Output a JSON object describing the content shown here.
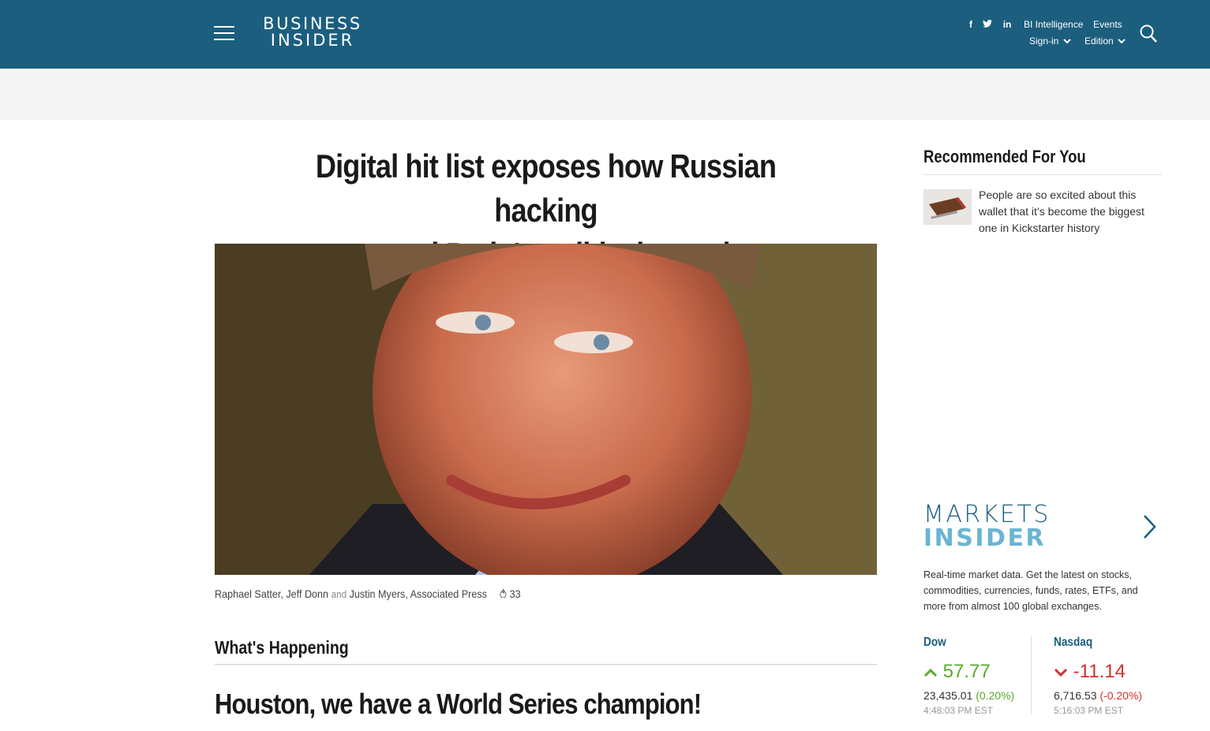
{
  "header": {
    "brand_line1": "BUSINESS",
    "brand_line2": "INSIDER",
    "social": [
      "f",
      "t",
      "in"
    ],
    "links": {
      "bi_intelligence": "BI Intelligence",
      "events": "Events",
      "signin": "Sign-in",
      "edition": "Edition"
    },
    "colors": {
      "bar": "#1b5e7e"
    }
  },
  "article": {
    "headline_line1": "Digital hit list exposes how Russian hacking",
    "headline_line2": "targeted Putin's political enemies",
    "author1": "Raphael Satter, Jeff Donn",
    "and": "and",
    "author2": "Justin Myers, Associated Press",
    "comment_count": "33",
    "hero_image": "person-portrait-photo"
  },
  "whats_happening": {
    "title": "What's Happening",
    "story": "Houston, we have a World Series champion!"
  },
  "sidebar": {
    "recommended_title": "Recommended For You",
    "rec_item_text": "People are so excited about this wallet that it’s become the biggest one in Kickstarter history",
    "markets_line1": "MARKETS",
    "markets_line2": "INSIDER",
    "markets_desc": "Real-time market data. Get the latest on stocks, commodities, currencies, funds, rates, ETFs, and more from almost 100 global exchanges.",
    "tickers": [
      {
        "name": "Dow",
        "change": "57.77",
        "value": "23,435.01",
        "pct": "(0.20%)",
        "time": "4:48:03 PM EST",
        "direction": "up"
      },
      {
        "name": "Nasdaq",
        "change": "-11.14",
        "value": "6,716.53",
        "pct": "(-0.20%)",
        "time": "5:16:03 PM EST",
        "direction": "down"
      }
    ]
  }
}
